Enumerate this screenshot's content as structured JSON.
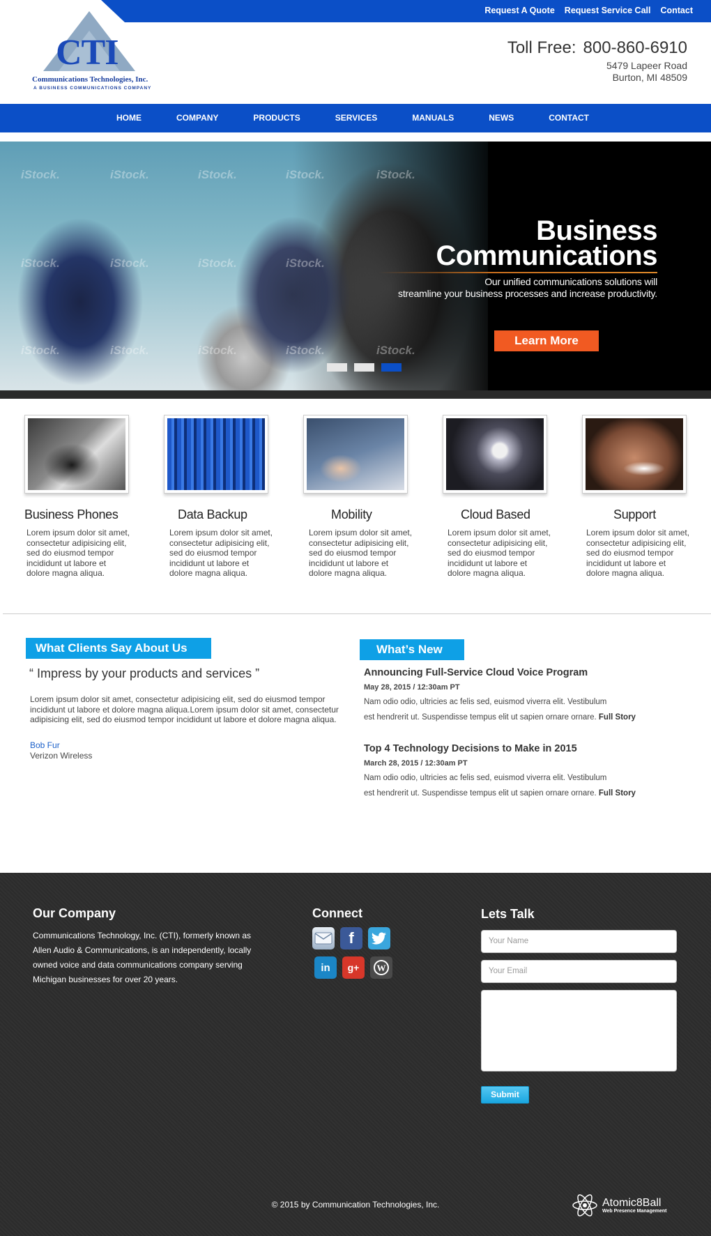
{
  "toplinks": {
    "quote": "Request A Quote",
    "service": "Request Service Call",
    "contact": "Contact"
  },
  "logo": {
    "mark": "CTI",
    "name": "Communications Technologies, Inc.",
    "sub": "A BUSINESS COMMUNICATIONS COMPANY"
  },
  "header": {
    "toll_label": "Toll Free:",
    "toll_number": "800-860-6910",
    "address1": "5479 Lapeer Road",
    "address2": "Burton, MI 48509"
  },
  "nav": {
    "items": [
      "HOME",
      "COMPANY",
      "PRODUCTS",
      "SERVICES",
      "MANUALS",
      "NEWS",
      "CONTACT"
    ]
  },
  "hero": {
    "title1": "Business",
    "title2": "Communications",
    "tagline1": "Our unified communications solutions will",
    "tagline2": "streamline your business processes and increase productivity.",
    "button": "Learn More",
    "watermark": "iStock.",
    "slides": 3,
    "active_slide": 3
  },
  "features": [
    {
      "title": "Business Phones",
      "text": "Lorem ipsum dolor sit amet, consectetur adipisicing elit, sed do eiusmod tempor incididunt ut labore et dolore magna aliqua."
    },
    {
      "title": "Data Backup",
      "text": "Lorem ipsum dolor sit amet, consectetur adipisicing elit, sed do eiusmod tempor incididunt ut labore et dolore magna aliqua."
    },
    {
      "title": "Mobility",
      "text": "Lorem ipsum dolor sit amet, consectetur adipisicing elit, sed do eiusmod tempor incididunt ut labore et dolore magna aliqua."
    },
    {
      "title": "Cloud Based",
      "text": "Lorem ipsum dolor sit amet, consectetur adipisicing elit, sed do eiusmod tempor incididunt ut labore et dolore magna aliqua."
    },
    {
      "title": "Support",
      "text": "Lorem ipsum dolor sit amet, consectetur adipisicing elit, sed do eiusmod tempor incididunt ut labore et dolore magna aliqua."
    }
  ],
  "clients": {
    "heading": "What Clients Say About Us",
    "quote": "“ Impress by your products and services ”",
    "text": "Lorem ipsum dolor sit amet, consectetur adipisicing elit, sed do eiusmod tempor incididunt ut labore et dolore magna aliqua.Lorem ipsum dolor sit amet, consectetur adipisicing elit, sed do eiusmod tempor incididunt ut labore et dolore magna aliqua.",
    "name": "Bob Fur",
    "company": "Verizon Wireless"
  },
  "news": {
    "heading": "What’s New",
    "items": [
      {
        "title": "Announcing Full-Service Cloud Voice Program",
        "date": "May 28, 2015 / 12:30am PT",
        "line1": "Nam odio odio, ultricies ac felis sed, euismod viverra elit. Vestibulum",
        "line2": "est hendrerit ut. Suspendisse tempus elit ut sapien ornare ornare.",
        "link": "Full Story"
      },
      {
        "title": "Top 4 Technology Decisions to Make in 2015",
        "date": "March 28, 2015 / 12:30am PT",
        "line1": "Nam odio odio, ultricies ac felis sed, euismod viverra elit. Vestibulum",
        "line2": "est hendrerit ut. Suspendisse tempus elit ut sapien ornare ornare.",
        "link": "Full Story"
      }
    ]
  },
  "footer": {
    "company_heading": "Our Company",
    "company_text": "Communications Technology, Inc. (CTI), formerly known as Allen Audio & Communications, is an independently, locally owned voice and data communications company serving Michigan businesses for over 20 years.",
    "connect_heading": "Connect",
    "talk_heading": "Lets Talk",
    "name_placeholder": "Your Name",
    "email_placeholder": "Your Email",
    "submit": "Submit",
    "copyright": "© 2015 by Communication Technologies, Inc.",
    "credit_name": "Atomic8Ball",
    "credit_sub": "Web Presence Management"
  },
  "colors": {
    "brand_blue": "#0b4fc7",
    "accent_cyan": "#0ea0e6",
    "cta_orange": "#f15a22",
    "footer_bg": "#2c2c2c"
  }
}
